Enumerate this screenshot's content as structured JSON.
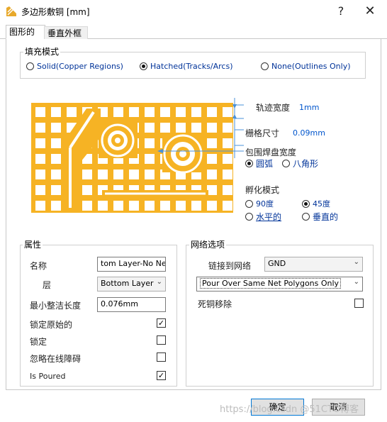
{
  "window": {
    "title": "多边形敷铜 [mm]",
    "help": "?",
    "close": "✕"
  },
  "tabs": [
    {
      "label": "图形的"
    },
    {
      "label": "垂直外框"
    }
  ],
  "fill_mode": {
    "title": "填充模式",
    "options": [
      {
        "label": "Solid(Copper Regions)",
        "selected": false
      },
      {
        "label": "Hatched(Tracks/Arcs)",
        "selected": true
      },
      {
        "label": "None(Outlines Only)",
        "selected": false
      }
    ]
  },
  "hatch": {
    "track_width_label": "轨迹宽度",
    "track_width_value": "1mm",
    "grid_size_label": "栅格尺寸",
    "grid_size_value": "0.09mm",
    "surround_label": "包围焊盘宽度",
    "surround_options": [
      {
        "label": "圆弧",
        "selected": true
      },
      {
        "label": "八角形",
        "selected": false
      }
    ],
    "hatch_mode_label": "孵化模式",
    "hatch_options": [
      {
        "label": "90度",
        "selected": false
      },
      {
        "label": "45度",
        "selected": true
      },
      {
        "label": "水平的",
        "selected": false
      },
      {
        "label": "垂直的",
        "selected": false
      }
    ],
    "preview_color": "#f6b324"
  },
  "properties": {
    "title": "属性",
    "name_label": "名称",
    "name_value": "tom Layer-No Net",
    "layer_label": "层",
    "layer_value": "Bottom Layer",
    "min_len_label": "最小整洁长度",
    "min_len_value": "0.076mm",
    "lock_primitives_label": "锁定原始的",
    "lock_primitives": true,
    "locked_label": "锁定",
    "locked": false,
    "ignore_obstacles_label": "忽略在线障碍",
    "ignore_obstacles": false,
    "is_poured_label": "Is Poured",
    "is_poured": true
  },
  "net_options": {
    "title": "网络选项",
    "connect_label": "链接到网络",
    "connect_value": "GND",
    "pour_mode_value": "Pour Over Same Net Polygons Only",
    "remove_dead_label": "死铜移除",
    "remove_dead": false
  },
  "buttons": {
    "ok": "确定",
    "cancel": "取消"
  },
  "watermark": "https://blog.csdn @51CTO博客"
}
